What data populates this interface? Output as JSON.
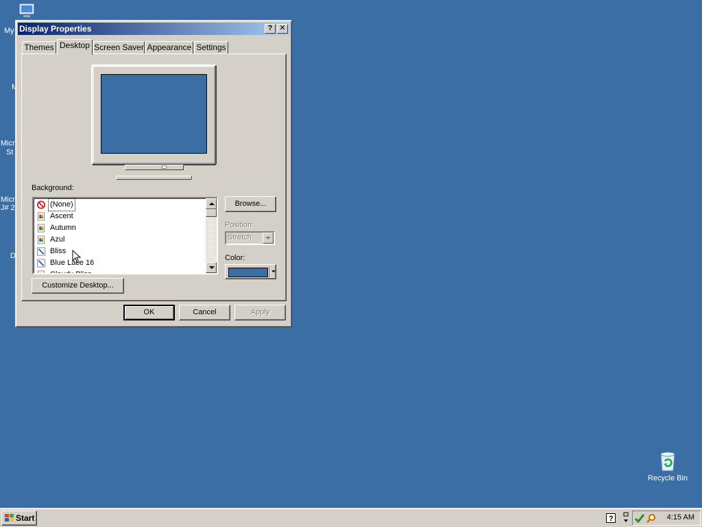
{
  "desktop": {
    "icons": {
      "my_computer": "My",
      "icon2": "M",
      "icon3_line1": "Micro",
      "icon3_line2": "St",
      "icon4_line1": "Micro",
      "icon4_line2": "J# 2",
      "icon5": "D",
      "recycle_bin": "Recycle Bin"
    },
    "background_color": "#3a6ea5"
  },
  "window": {
    "title": "Display Properties",
    "help_button": "?",
    "close_button": "✕",
    "tabs": [
      "Themes",
      "Desktop",
      "Screen Saver",
      "Appearance",
      "Settings"
    ],
    "active_tab": "Desktop",
    "background_label": "Background:",
    "background_items": [
      {
        "label": "(None)",
        "icon": "none-icon",
        "selected": true
      },
      {
        "label": "Ascent",
        "icon": "image-file-icon"
      },
      {
        "label": "Autumn",
        "icon": "image-file-icon"
      },
      {
        "label": "Azul",
        "icon": "image-file-icon"
      },
      {
        "label": "Bliss",
        "icon": "bitmap-file-icon"
      },
      {
        "label": "Blue Lace 16",
        "icon": "bitmap-file-icon"
      },
      {
        "label": "Cloudy Bliss",
        "icon": "image-file-icon"
      }
    ],
    "browse_button": "Browse...",
    "position_label": "Position:",
    "position_value": "Stretch",
    "color_label": "Color:",
    "color_value": "#3a6ea5",
    "customize_button": "Customize Desktop...",
    "ok_button": "OK",
    "cancel_button": "Cancel",
    "apply_button": "Apply"
  },
  "taskbar": {
    "start_label": "Start",
    "clock": "4:15 AM"
  }
}
